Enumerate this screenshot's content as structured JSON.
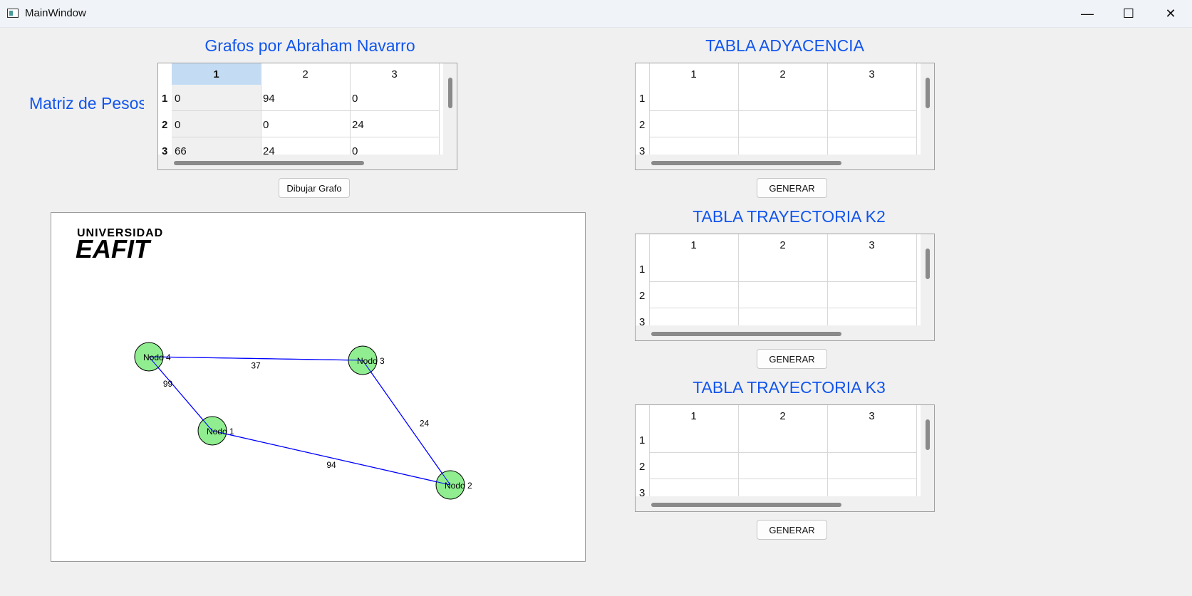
{
  "window": {
    "title": "MainWindow",
    "minimize": "—",
    "maximize": "☐",
    "close": "✕"
  },
  "main_title": "Grafos por Abraham Navarro",
  "weights_label": "Matriz de Pesos:",
  "weights_table": {
    "columns": [
      "1",
      "2",
      "3"
    ],
    "rows": [
      {
        "header": "1",
        "cells": [
          "0",
          "94",
          "0"
        ]
      },
      {
        "header": "2",
        "cells": [
          "0",
          "0",
          "24"
        ]
      },
      {
        "header": "3",
        "cells": [
          "66",
          "24",
          "0"
        ]
      }
    ]
  },
  "draw_button": "Dibujar Grafo",
  "adjacency": {
    "title": "TABLA ADYACENCIA",
    "columns": [
      "1",
      "2",
      "3"
    ],
    "rows": [
      "1",
      "2",
      "3"
    ],
    "button": "GENERAR"
  },
  "k2": {
    "title": "TABLA TRAYECTORIA K2",
    "columns": [
      "1",
      "2",
      "3"
    ],
    "rows": [
      "1",
      "2",
      "3"
    ],
    "button": "GENERAR"
  },
  "k3": {
    "title": "TABLA TRAYECTORIA K3",
    "columns": [
      "1",
      "2",
      "3"
    ],
    "rows": [
      "1",
      "2",
      "3"
    ],
    "button": "GENERAR"
  },
  "logo": {
    "line1": "UNIVERSIDAD",
    "line2": "EAFIT"
  },
  "graph": {
    "node_color": "#90ee90",
    "edge_color": "#0000ff",
    "nodes": [
      {
        "label": "Nodo 4"
      },
      {
        "label": "Nodo 3"
      },
      {
        "label": "Nodo 1"
      },
      {
        "label": "Nodo 2"
      }
    ],
    "edges": [
      {
        "from": "Nodo 4",
        "to": "Nodo 3",
        "weight": "37"
      },
      {
        "from": "Nodo 4",
        "to": "Nodo 1",
        "weight": "99"
      },
      {
        "from": "Nodo 3",
        "to": "Nodo 2",
        "weight": "24"
      },
      {
        "from": "Nodo 1",
        "to": "Nodo 2",
        "weight": "94"
      }
    ]
  }
}
